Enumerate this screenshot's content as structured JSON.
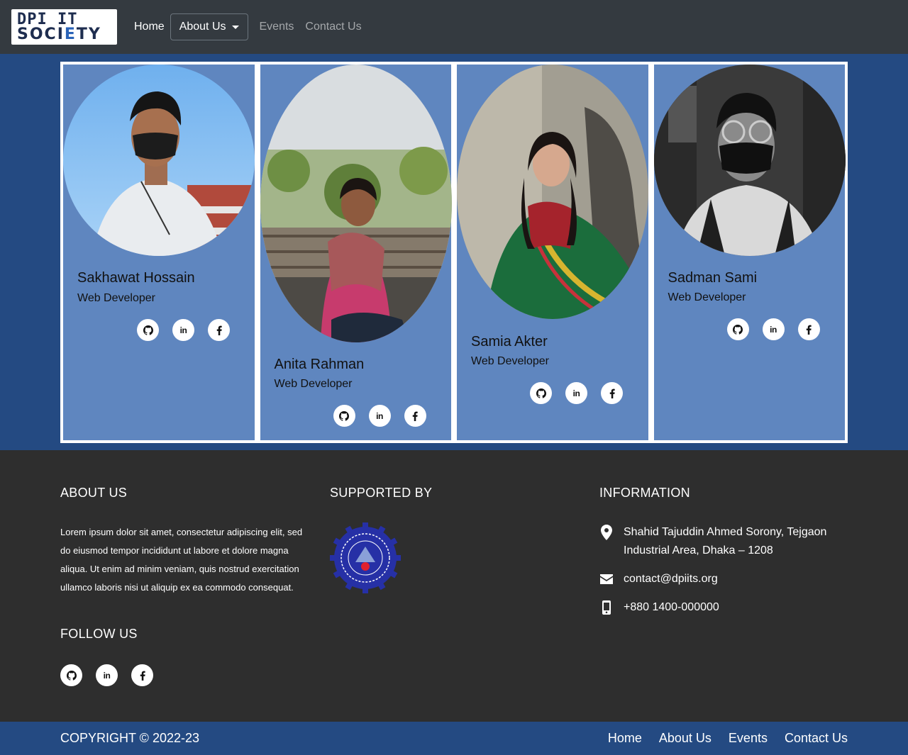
{
  "navbar": {
    "logo_line1": "DPI IT",
    "logo_line2_a": "SOCI",
    "logo_line2_b": "E",
    "logo_line2_c": "TY",
    "links": {
      "home": "Home",
      "about": "About Us",
      "events": "Events",
      "contact": "Contact Us"
    }
  },
  "team": [
    {
      "name": "Sakhawat Hossain",
      "role": "Web Developer"
    },
    {
      "name": "Anita Rahman",
      "role": "Web Developer"
    },
    {
      "name": "Samia Akter",
      "role": "Web Developer"
    },
    {
      "name": "Sadman Sami",
      "role": "Web Developer"
    }
  ],
  "footer": {
    "about_heading": "ABOUT US",
    "about_text": "Lorem ipsum dolor sit amet, consectetur adipiscing elit, sed do eiusmod tempor incididunt ut labore et dolore magna aliqua. Ut enim ad minim veniam, quis nostrud exercitation ullamco laboris nisi ut aliquip ex ea commodo consequat.",
    "follow_heading": "FOLLOW US",
    "supported_heading": "SUPPORTED BY",
    "info_heading": "INFORMATION",
    "address": "Shahid Tajuddin Ahmed Sorony, Tejgaon Industrial Area, Dhaka – 1208",
    "email": "contact@dpiits.org",
    "phone": "+880 1400-000000"
  },
  "bottom": {
    "copyright": "COPYRIGHT © 2022-23",
    "links": {
      "home": "Home",
      "about": "About Us",
      "events": "Events",
      "contact": "Contact Us"
    }
  },
  "colors": {
    "navbar_bg": "#343a40",
    "team_bg": "#244a82",
    "card_bg": "#5f86bf",
    "footer_bg": "#2e2e2e",
    "bottom_bar_bg": "#244a82"
  }
}
